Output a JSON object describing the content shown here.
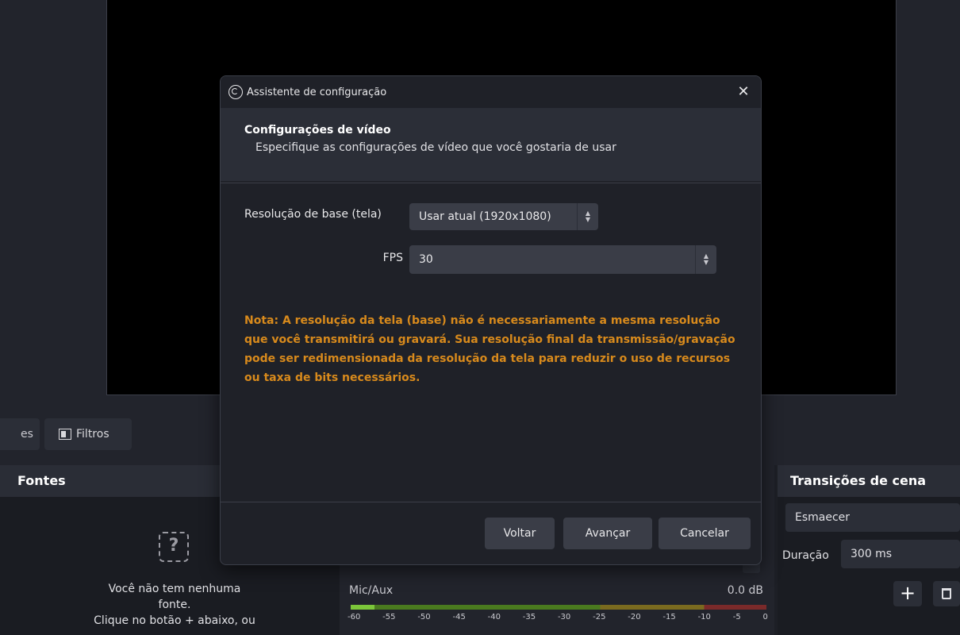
{
  "background": {
    "context_bar": {
      "partial_tab_label": "es",
      "filters_label": "Filtros"
    },
    "sources": {
      "title": "Fontes",
      "placeholder_icon": "?",
      "empty_message_line1": "Você não tem nenhuma",
      "empty_message_line2": "fonte.",
      "empty_message_line3": "Clique no botão + abaixo, ou"
    },
    "mixer": {
      "channel_name": "Mic/Aux",
      "channel_db": "0.0 dB",
      "ticks": [
        "-60",
        "-55",
        "-50",
        "-45",
        "-40",
        "-35",
        "-30",
        "-25",
        "-20",
        "-15",
        "-10",
        "-5",
        "0"
      ]
    },
    "transitions": {
      "title": "Transições de cena",
      "selected_transition": "Esmaecer",
      "duration_label": "Duração",
      "duration_value": "300 ms",
      "add_label": "+"
    }
  },
  "dialog": {
    "title": "Assistente de configuração",
    "close_glyph": "✕",
    "header": {
      "title": "Configurações de vídeo",
      "subtitle": "Especifique as configurações de vídeo que você gostaria de usar"
    },
    "form": {
      "base_resolution_label": "Resolução de base (tela)",
      "base_resolution_value": "Usar atual (1920x1080)",
      "fps_label": "FPS",
      "fps_value": "30"
    },
    "note": "Nota: A resolução da tela (base) não é necessariamente a mesma resolução que você transmitirá ou gravará. Sua resolução final da transmissão/gravação pode ser redimensionada da resolução da tela para reduzir o uso de recursos ou taxa de bits necessários.",
    "buttons": {
      "back": "Voltar",
      "next": "Avançar",
      "cancel": "Cancelar"
    }
  },
  "colors": {
    "note_color": "#d88a1c",
    "dialog_bg": "#1f2128",
    "header_bg": "#2b2e37"
  }
}
